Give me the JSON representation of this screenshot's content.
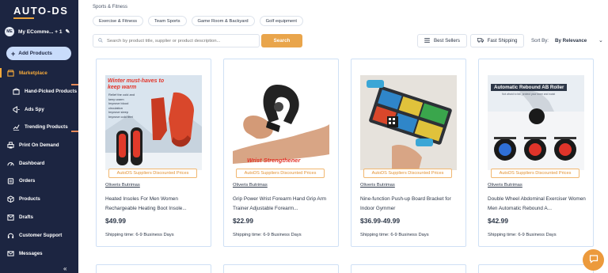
{
  "app": {
    "logo_text": "AUTO-DS",
    "store_initials": "ME",
    "store_name": "My EComme... + 1",
    "add_products_label": "Add Products",
    "collapse_label": "«"
  },
  "sidebar": {
    "items": [
      {
        "label": "Marketplace",
        "icon": "store-icon",
        "active": true
      },
      {
        "label": "Hand-Picked Products",
        "icon": "box-icon"
      },
      {
        "label": "Ads Spy",
        "icon": "megaphone-icon"
      },
      {
        "label": "Trending Products",
        "icon": "trend-icon"
      },
      {
        "label": "Print On Demand",
        "icon": "printer-icon"
      },
      {
        "label": "Dashboard",
        "icon": "gauge-icon"
      },
      {
        "label": "Orders",
        "icon": "cart-icon"
      },
      {
        "label": "Products",
        "icon": "cube-icon"
      },
      {
        "label": "Drafts",
        "icon": "drafts-icon"
      },
      {
        "label": "Customer Support",
        "icon": "headset-icon"
      },
      {
        "label": "Messages",
        "icon": "mail-icon"
      }
    ]
  },
  "breadcrumb": "Sports & Fitness",
  "categories": [
    "Exercise & Fitness",
    "Team Sports",
    "Game Room & Backyard",
    "Golf equipment"
  ],
  "search": {
    "placeholder": "Search by product title, supplier or product description...",
    "button_label": "Search"
  },
  "filters": {
    "best_sellers": "Best Sellers",
    "fast_shipping": "Fast Shipping",
    "sort_label": "Sort By:",
    "sort_value": "By Relevance"
  },
  "products": [
    {
      "badge": "AutoDS Suppliers Discounted Prices",
      "supplier": "Oliveris Butrimas",
      "title": "Heated Insoles For Men Women Rechargeable Heating Boot Insole...",
      "price": "$49.99",
      "shipping": "Shipping time: 6-9 Business Days",
      "image_caption": "Winter must-haves to keep warm",
      "image_bullets": [
        "Relief the cold and",
        "keep warm",
        "Improve blood",
        "circulation",
        "Improve sleep",
        "Improve cold feet"
      ]
    },
    {
      "badge": "AutoDS Suppliers Discounted Prices",
      "supplier": "Oliveris Butrimas",
      "title": "Grip Power Wrist Forearm Hand Grip Arm Trainer Adjustable Forearm...",
      "price": "$22.99",
      "shipping": "Shipping time: 6-9 Business Days",
      "image_caption": "Wrist Strengthener"
    },
    {
      "badge": "AutoDS Suppliers Discounted Prices",
      "supplier": "Oliveris Butrimas",
      "title": "Nine-function Push-up Board Bracket for Indoor Gymmer",
      "price": "$36.99-49.99",
      "shipping": "Shipping time: 6-9 Business Days"
    },
    {
      "badge": "AutoDS Suppliers Discounted Prices",
      "supplier": "Oliveris Butrimas",
      "title": "Double Wheel Abdominal Exerciser Women Men Automatic Rebound A...",
      "price": "$42.99",
      "shipping": "Shipping time: 6-9 Business Days",
      "image_caption": "Automatic Rebound AB Roller",
      "image_subcaption": "Not afraid to fall, protect your knee and waist"
    }
  ],
  "colors": {
    "sidebar_bg": "#1c2541",
    "accent": "#e9a54b",
    "active_nav": "#f4a93b",
    "card_border": "#cfe0f5",
    "badge": "#e39233"
  }
}
